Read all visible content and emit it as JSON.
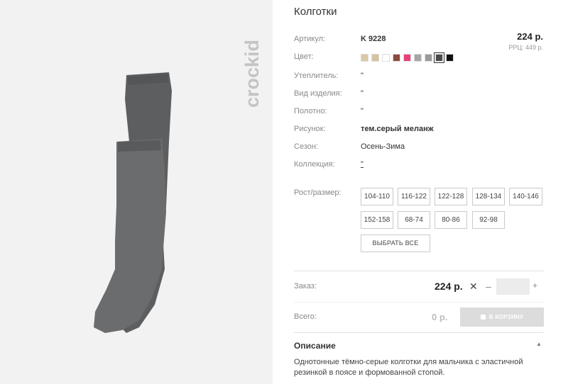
{
  "product": {
    "title": "Колготки",
    "price": "224 р.",
    "rrp": "РРЦ: 449 р.",
    "brand_logo_text": "crockid"
  },
  "attributes": [
    {
      "label": "Артикул:",
      "value": "K 9228"
    },
    {
      "label": "Цвет:",
      "value": ""
    },
    {
      "label": "Утеплитель:",
      "value": "\""
    },
    {
      "label": "Вид изделия:",
      "value": "\""
    },
    {
      "label": "Полотно:",
      "value": "\""
    },
    {
      "label": "Рисунок:",
      "value": "тем.серый меланж"
    },
    {
      "label": "Сезон:",
      "value": "Осень-Зима"
    },
    {
      "label": "Коллекция:",
      "value": "\""
    }
  ],
  "colors": [
    "#d9c9a6",
    "#d6c2a0",
    "#ffffff",
    "#8b4a3c",
    "#e8407a",
    "#a6a6a6",
    "#9a9a9a",
    "#4a4a4a",
    "#111111"
  ],
  "selected_color_index": 7,
  "size_label": "Рост/размер:",
  "sizes": [
    "104-110",
    "116-122",
    "122-128",
    "128-134",
    "140-146",
    "152-158",
    "68-74",
    "80-86",
    "92-98"
  ],
  "select_all_label": "ВЫБРАТЬ ВСЕ",
  "order": {
    "label": "Заказ:",
    "price": "224 р.",
    "times": "✕",
    "minus": "–",
    "plus": "+",
    "quantity": ""
  },
  "total": {
    "label": "Всего:",
    "value": "0 р.",
    "cart_label": "В КОРЗИНУ"
  },
  "description": {
    "title": "Описание",
    "toggle": "▲",
    "text": "Однотонные тёмно-серые колготки для мальчика с эластичной резинкой в поясе и формованной стопой."
  }
}
